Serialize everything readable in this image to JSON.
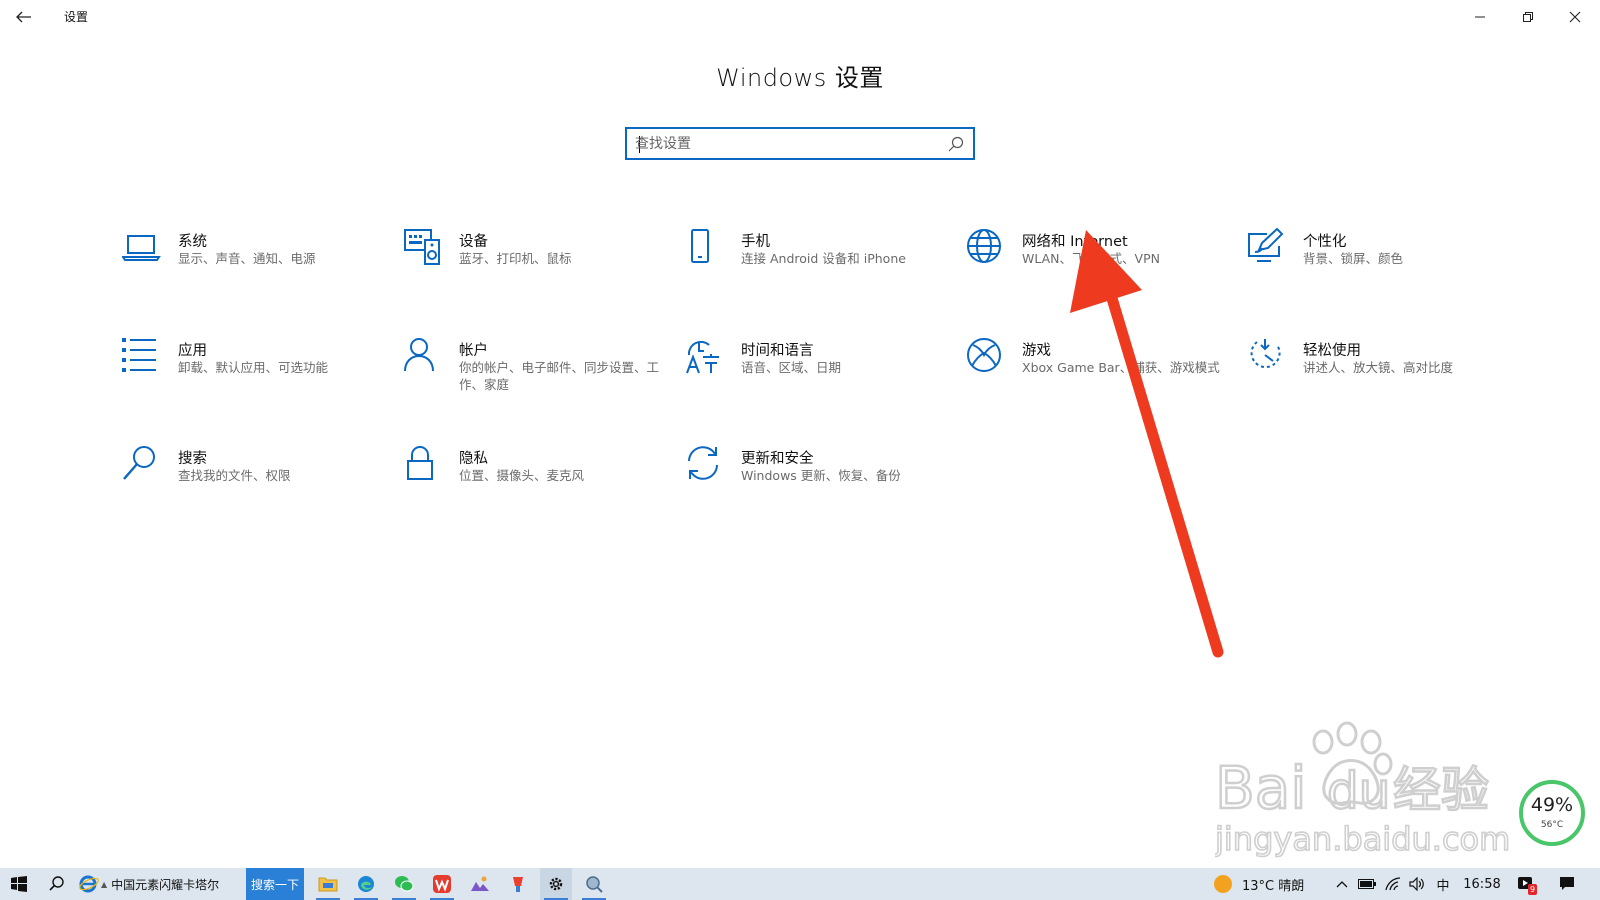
{
  "window": {
    "app_title": "设置",
    "page_title": "Windows 设置"
  },
  "search": {
    "placeholder": "查找设置"
  },
  "tiles": [
    {
      "label": "系统",
      "desc": "显示、声音、通知、电源",
      "icon": "laptop-icon"
    },
    {
      "label": "设备",
      "desc": "蓝牙、打印机、鼠标",
      "icon": "devices-icon"
    },
    {
      "label": "手机",
      "desc": "连接 Android 设备和 iPhone",
      "icon": "phone-icon"
    },
    {
      "label": "网络和 Internet",
      "desc": "WLAN、飞行模式、VPN",
      "icon": "globe-icon"
    },
    {
      "label": "个性化",
      "desc": "背景、锁屏、颜色",
      "icon": "personalize-icon"
    },
    {
      "label": "应用",
      "desc": "卸载、默认应用、可选功能",
      "icon": "apps-list-icon"
    },
    {
      "label": "帐户",
      "desc": "你的帐户、电子邮件、同步设置、工作、家庭",
      "icon": "person-icon"
    },
    {
      "label": "时间和语言",
      "desc": "语音、区域、日期",
      "icon": "time-language-icon"
    },
    {
      "label": "游戏",
      "desc": "Xbox Game Bar、捕获、游戏模式",
      "icon": "xbox-icon"
    },
    {
      "label": "轻松使用",
      "desc": "讲述人、放大镜、高对比度",
      "icon": "ease-of-access-icon"
    },
    {
      "label": "搜索",
      "desc": "查找我的文件、权限",
      "icon": "search-icon"
    },
    {
      "label": "隐私",
      "desc": "位置、摄像头、麦克风",
      "icon": "lock-icon"
    },
    {
      "label": "更新和安全",
      "desc": "Windows 更新、恢复、备份",
      "icon": "sync-icon"
    }
  ],
  "watermark": {
    "brand": "Bai",
    "brand2": "du",
    "brand_cn": "经验",
    "url": "jingyan.baidu.com"
  },
  "battery_widget": {
    "percent": "49%",
    "temp": "56°C"
  },
  "taskbar": {
    "browser_tab": "中国元素闪耀卡塔尔",
    "search_button": "搜索一下",
    "weather": "13°C 晴朗",
    "ime": "中",
    "time": "16:58",
    "notification_badge": "9"
  },
  "colors": {
    "accent": "#0a67c2",
    "arrow": "#ee3a1f"
  }
}
